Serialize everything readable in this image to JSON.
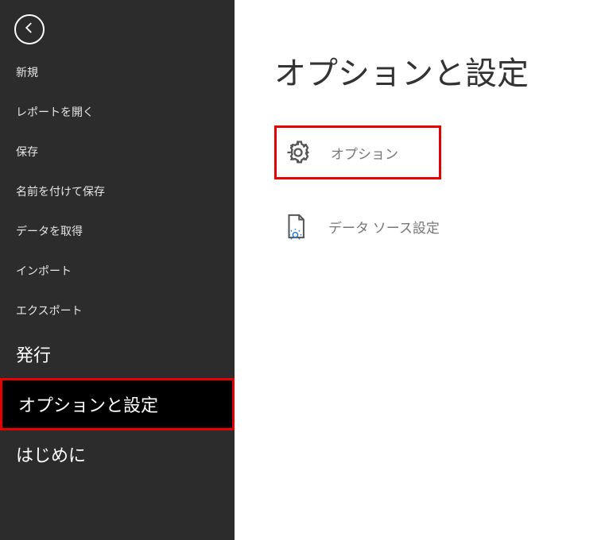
{
  "sidebar": {
    "items": [
      {
        "label": "新規"
      },
      {
        "label": "レポートを開く"
      },
      {
        "label": "保存"
      },
      {
        "label": "名前を付けて保存"
      },
      {
        "label": "データを取得"
      },
      {
        "label": "インポート"
      },
      {
        "label": "エクスポート"
      },
      {
        "label": "発行"
      },
      {
        "label": "オプションと設定"
      },
      {
        "label": "はじめに"
      }
    ]
  },
  "main": {
    "title": "オプションと設定",
    "options": [
      {
        "label": "オプション"
      },
      {
        "label": "データ ソース設定"
      }
    ]
  }
}
